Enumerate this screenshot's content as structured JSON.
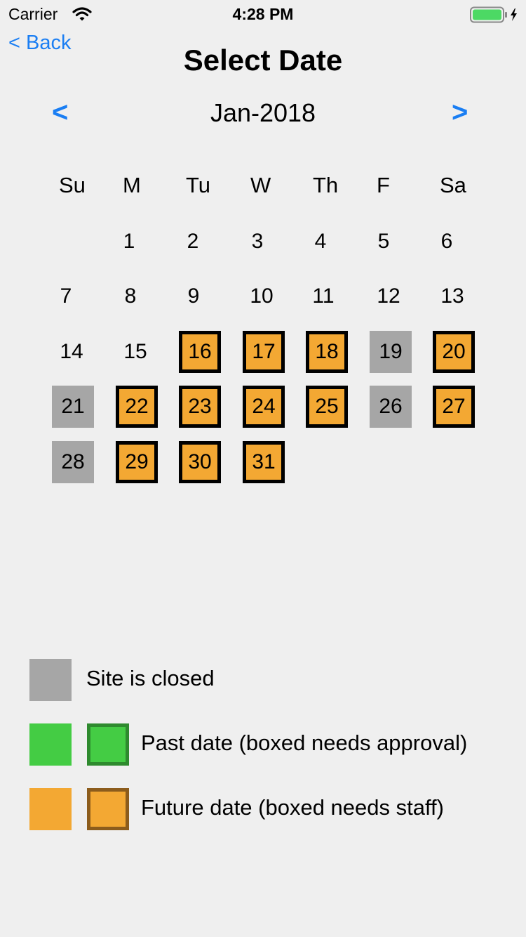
{
  "status_bar": {
    "carrier": "Carrier",
    "time": "4:28 PM"
  },
  "nav": {
    "back_label": "< Back",
    "title": "Select Date"
  },
  "calendar": {
    "prev_label": "<",
    "next_label": ">",
    "month_label": "Jan-2018",
    "weekdays": [
      "Su",
      "M",
      "Tu",
      "W",
      "Th",
      "F",
      "Sa"
    ],
    "days": [
      {
        "day": "1",
        "status": "normal"
      },
      {
        "day": "2",
        "status": "normal"
      },
      {
        "day": "3",
        "status": "normal"
      },
      {
        "day": "4",
        "status": "normal"
      },
      {
        "day": "5",
        "status": "normal"
      },
      {
        "day": "6",
        "status": "normal"
      },
      {
        "day": "7",
        "status": "normal"
      },
      {
        "day": "8",
        "status": "normal"
      },
      {
        "day": "9",
        "status": "normal"
      },
      {
        "day": "10",
        "status": "normal"
      },
      {
        "day": "11",
        "status": "normal"
      },
      {
        "day": "12",
        "status": "normal"
      },
      {
        "day": "13",
        "status": "normal"
      },
      {
        "day": "14",
        "status": "normal"
      },
      {
        "day": "15",
        "status": "normal"
      },
      {
        "day": "16",
        "status": "future-boxed"
      },
      {
        "day": "17",
        "status": "future-boxed"
      },
      {
        "day": "18",
        "status": "future-boxed"
      },
      {
        "day": "19",
        "status": "closed"
      },
      {
        "day": "20",
        "status": "future-boxed"
      },
      {
        "day": "21",
        "status": "closed"
      },
      {
        "day": "22",
        "status": "future-boxed"
      },
      {
        "day": "23",
        "status": "future-boxed"
      },
      {
        "day": "24",
        "status": "future-boxed"
      },
      {
        "day": "25",
        "status": "future-boxed"
      },
      {
        "day": "26",
        "status": "closed"
      },
      {
        "day": "27",
        "status": "future-boxed"
      },
      {
        "day": "28",
        "status": "closed"
      },
      {
        "day": "29",
        "status": "future-boxed"
      },
      {
        "day": "30",
        "status": "future-boxed"
      },
      {
        "day": "31",
        "status": "future-boxed"
      }
    ]
  },
  "legend": {
    "closed_label": "Site is closed",
    "past_label": "Past date (boxed needs approval)",
    "future_label": "Future date (boxed needs staff)"
  },
  "colors": {
    "accent": "#1a7ef3",
    "closed": "#a6a6a6",
    "past": "#44cc44",
    "past_border": "#2e8a2e",
    "future": "#f3a833",
    "future_border": "#8c5c1c"
  }
}
